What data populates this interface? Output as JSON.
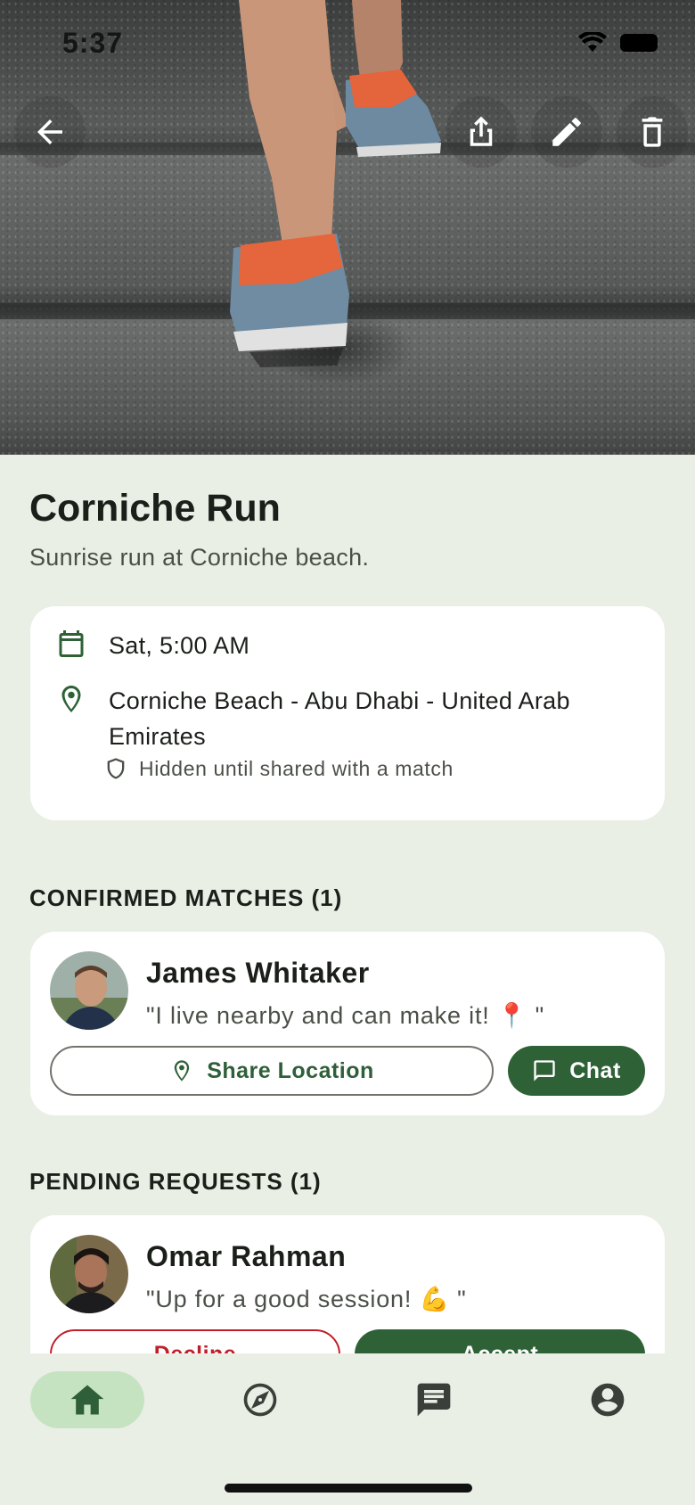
{
  "status_bar": {
    "time": "5:37"
  },
  "hero": {
    "back_icon": "arrow-left-icon",
    "share_icon": "share-icon",
    "edit_icon": "pencil-icon",
    "delete_icon": "trash-icon"
  },
  "event": {
    "title": "Corniche Run",
    "description": "Sunrise run at Corniche beach.",
    "datetime": "Sat, 5:00 AM",
    "location": "Corniche Beach - Abu Dhabi - United Arab Emirates",
    "location_note": "Hidden until shared with a match"
  },
  "confirmed": {
    "label": "CONFIRMED MATCHES (1)",
    "items": [
      {
        "name": "James Whitaker",
        "message": "\"I live nearby and can make it! 📍 \"",
        "share_label": "Share Location",
        "chat_label": "Chat"
      }
    ]
  },
  "pending": {
    "label": "PENDING REQUESTS (1)",
    "items": [
      {
        "name": "Omar Rahman",
        "message": "\"Up for a good session! 💪 \"",
        "decline_label": "Decline",
        "accept_label": "Accept"
      }
    ]
  },
  "nav": {
    "items": [
      {
        "icon": "home-icon",
        "active": true
      },
      {
        "icon": "compass-icon",
        "active": false
      },
      {
        "icon": "chat-icon",
        "active": false
      },
      {
        "icon": "account-icon",
        "active": false
      }
    ]
  },
  "colors": {
    "background": "#eaefe6",
    "primary": "#2f6136",
    "nav_active": "#c6e3c1",
    "decline": "#c01f2a"
  }
}
